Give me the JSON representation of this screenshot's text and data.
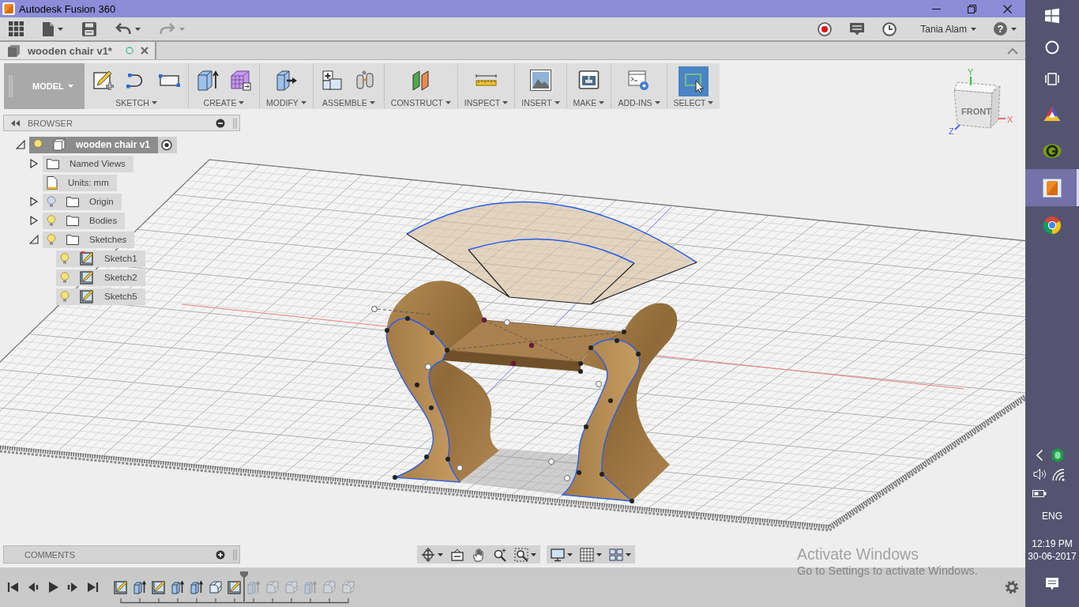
{
  "window": {
    "title": "Autodesk Fusion 360"
  },
  "quick_access": {
    "undo": {
      "disabled": false
    },
    "redo": {
      "disabled": true
    },
    "user": "Tania Alam",
    "help": "?"
  },
  "document_tabs": [
    {
      "label": "wooden chair v1*",
      "selected": true
    }
  ],
  "toolbar": {
    "workspace": "MODEL",
    "groups": [
      {
        "label": "SKETCH",
        "selected": false
      },
      {
        "label": "CREATE",
        "selected": false
      },
      {
        "label": "MODIFY",
        "selected": false
      },
      {
        "label": "ASSEMBLE",
        "selected": false
      },
      {
        "label": "CONSTRUCT",
        "selected": false
      },
      {
        "label": "INSPECT",
        "selected": false
      },
      {
        "label": "INSERT",
        "selected": false
      },
      {
        "label": "MAKE",
        "selected": false
      },
      {
        "label": "ADD-INS",
        "selected": false
      },
      {
        "label": "SELECT",
        "selected": true
      }
    ]
  },
  "browser": {
    "title": "BROWSER",
    "tree": [
      {
        "label": "wooden chair v1",
        "kind": "component",
        "visible": true,
        "expanded": true,
        "active": true,
        "children": [
          {
            "label": "Named Views",
            "kind": "folder",
            "expanded": false
          },
          {
            "label": "Units: mm",
            "kind": "units"
          },
          {
            "label": "Origin",
            "kind": "folder",
            "visible": false,
            "expanded": false
          },
          {
            "label": "Bodies",
            "kind": "folder",
            "visible": true,
            "expanded": false
          },
          {
            "label": "Sketches",
            "kind": "folder",
            "visible": true,
            "expanded": true,
            "children": [
              {
                "label": "Sketch1",
                "kind": "sketch",
                "visible": true,
                "warning": true
              },
              {
                "label": "Sketch2",
                "kind": "sketch",
                "visible": true,
                "warning": false
              },
              {
                "label": "Sketch5",
                "kind": "sketch",
                "visible": true,
                "warning": false
              }
            ]
          }
        ]
      }
    ]
  },
  "view_cube": {
    "face": "FRONT",
    "x_axis": "X",
    "y_axis": "Y",
    "z_axis": "Z"
  },
  "comments": {
    "title": "COMMENTS"
  },
  "timeline": {
    "features": [
      {
        "kind": "sketch",
        "rolled_back": false
      },
      {
        "kind": "extrude",
        "rolled_back": false
      },
      {
        "kind": "sketch",
        "rolled_back": false
      },
      {
        "kind": "extrude",
        "rolled_back": false
      },
      {
        "kind": "extrude",
        "rolled_back": false
      },
      {
        "kind": "fillet",
        "rolled_back": false
      },
      {
        "kind": "sketch",
        "rolled_back": false
      },
      {
        "kind": "extrude",
        "rolled_back": true
      },
      {
        "kind": "fillet",
        "rolled_back": true
      },
      {
        "kind": "fillet",
        "rolled_back": true
      },
      {
        "kind": "extrude",
        "rolled_back": true
      },
      {
        "kind": "fillet",
        "rolled_back": true
      },
      {
        "kind": "fillet",
        "rolled_back": true
      }
    ]
  },
  "activation_notice": {
    "title": "Activate Windows",
    "hint": "Go to Settings to activate Windows."
  },
  "taskbar": {
    "apps": [
      {
        "selected": false
      },
      {
        "selected": false
      },
      {
        "selected": true
      },
      {
        "selected": false
      }
    ],
    "language": "ENG",
    "time": "12:19 PM",
    "date": "30-06-2017"
  }
}
